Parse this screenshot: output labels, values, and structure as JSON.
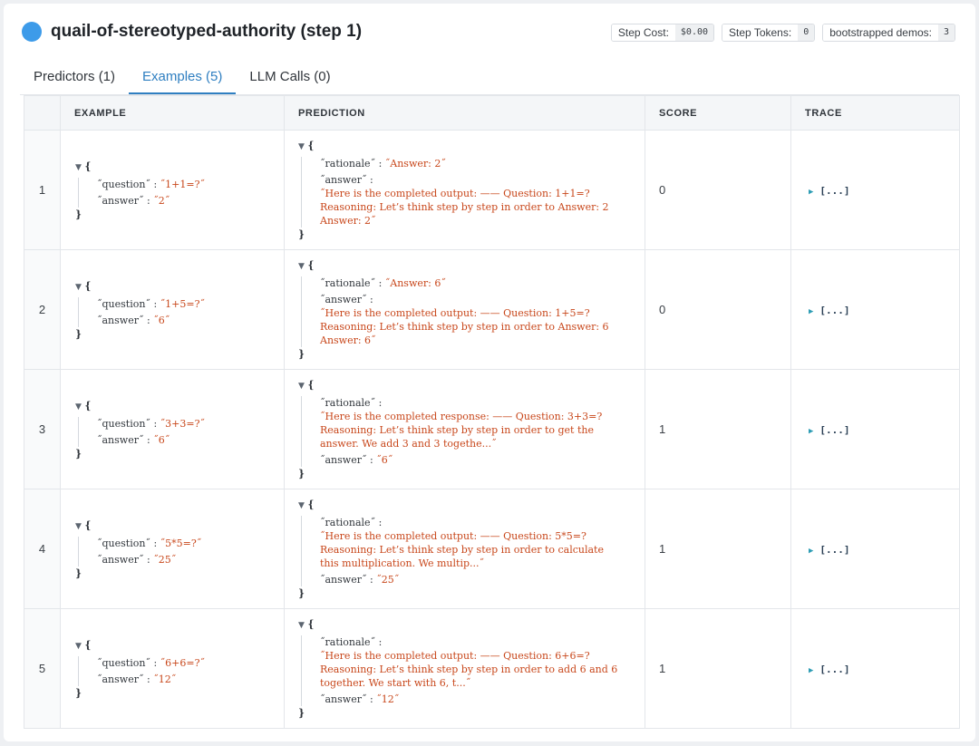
{
  "header": {
    "title": "quail-of-stereotyped-authority (step 1)",
    "badges": [
      {
        "label": "Step Cost:",
        "value": "$0.00"
      },
      {
        "label": "Step Tokens:",
        "value": "0"
      },
      {
        "label": "bootstrapped demos:",
        "value": "3"
      }
    ],
    "accent": "#3d9be9"
  },
  "tabs": [
    {
      "label": "Predictors (1)",
      "active": false
    },
    {
      "label": "Examples (5)",
      "active": true
    },
    {
      "label": "LLM Calls (0)",
      "active": false
    }
  ],
  "table": {
    "columns": [
      "",
      "EXAMPLE",
      "PREDICTION",
      "SCORE",
      "TRACE"
    ],
    "json_symbols": {
      "open": "{",
      "close": "}",
      "toggle": "▼",
      "colon": ":"
    },
    "trace_label": "[...]",
    "trace_toggle": "▶",
    "rows": [
      {
        "index": "1",
        "example": [
          {
            "key": "˝question˝",
            "value": "˝1+1=?˝"
          },
          {
            "key": "˝answer˝",
            "value": "˝2˝"
          }
        ],
        "prediction": [
          {
            "key": "˝rationale˝",
            "value": "˝Answer: 2˝",
            "long": false
          },
          {
            "key": "˝answer˝",
            "value": "˝Here is the completed output: —— Question: 1+1=? Reasoning: Let’s think step by step in order to Answer: 2 Answer: 2˝",
            "long": true
          }
        ],
        "score": "0"
      },
      {
        "index": "2",
        "example": [
          {
            "key": "˝question˝",
            "value": "˝1+5=?˝"
          },
          {
            "key": "˝answer˝",
            "value": "˝6˝"
          }
        ],
        "prediction": [
          {
            "key": "˝rationale˝",
            "value": "˝Answer: 6˝",
            "long": false
          },
          {
            "key": "˝answer˝",
            "value": "˝Here is the completed output: —— Question: 1+5=? Reasoning: Let’s think step by step in order to Answer: 6 Answer: 6˝",
            "long": true
          }
        ],
        "score": "0"
      },
      {
        "index": "3",
        "example": [
          {
            "key": "˝question˝",
            "value": "˝3+3=?˝"
          },
          {
            "key": "˝answer˝",
            "value": "˝6˝"
          }
        ],
        "prediction": [
          {
            "key": "˝rationale˝",
            "value": "˝Here is the completed response: —— Question: 3+3=? Reasoning: Let’s think step by step in order to get the answer. We add 3 and 3 togethe...˝",
            "long": true
          },
          {
            "key": "˝answer˝",
            "value": "˝6˝",
            "long": false
          }
        ],
        "score": "1"
      },
      {
        "index": "4",
        "example": [
          {
            "key": "˝question˝",
            "value": "˝5*5=?˝"
          },
          {
            "key": "˝answer˝",
            "value": "˝25˝"
          }
        ],
        "prediction": [
          {
            "key": "˝rationale˝",
            "value": "˝Here is the completed output: —— Question: 5*5=? Reasoning: Let’s think step by step in order to calculate this multiplication. We multip...˝",
            "long": true
          },
          {
            "key": "˝answer˝",
            "value": "˝25˝",
            "long": false
          }
        ],
        "score": "1"
      },
      {
        "index": "5",
        "example": [
          {
            "key": "˝question˝",
            "value": "˝6+6=?˝"
          },
          {
            "key": "˝answer˝",
            "value": "˝12˝"
          }
        ],
        "prediction": [
          {
            "key": "˝rationale˝",
            "value": "˝Here is the completed output: —— Question: 6+6=? Reasoning: Let’s think step by step in order to add 6 and 6 together. We start with 6, t...˝",
            "long": true
          },
          {
            "key": "˝answer˝",
            "value": "˝12˝",
            "long": false
          }
        ],
        "score": "1"
      }
    ]
  }
}
